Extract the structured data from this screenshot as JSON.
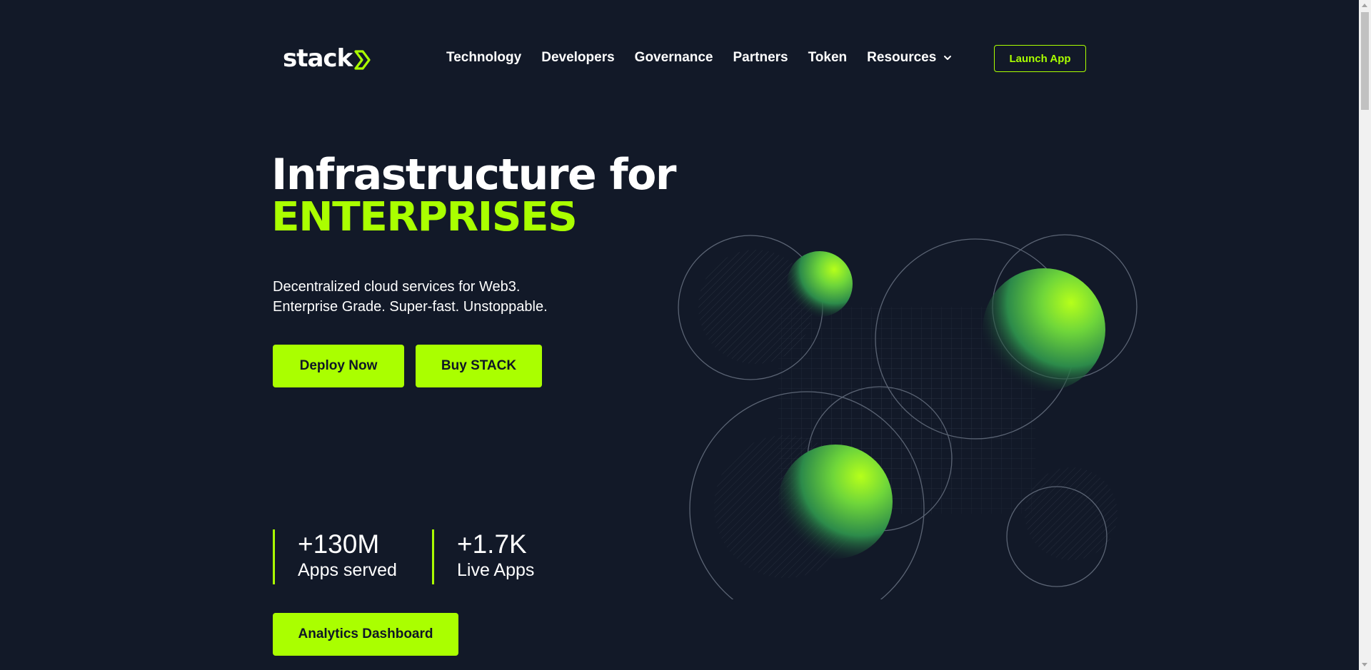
{
  "brand": {
    "logo_text": "stack",
    "accent": "#aaff00",
    "background": "#121928"
  },
  "nav": {
    "items": [
      {
        "label": "Technology"
      },
      {
        "label": "Developers"
      },
      {
        "label": "Governance"
      },
      {
        "label": "Partners"
      },
      {
        "label": "Token"
      },
      {
        "label": "Resources",
        "icon": "chevron-down-icon"
      }
    ],
    "launch_label": "Launch App"
  },
  "hero": {
    "title": "Infrastructure for",
    "accent": "ENTERPRISES",
    "subtitle_line1": "Decentralized cloud services for Web3.",
    "subtitle_line2": "Enterprise Grade. Super-fast. Unstoppable.",
    "primary_cta": "Deploy Now",
    "secondary_cta": "Buy STACK"
  },
  "stats": [
    {
      "value": "+130M",
      "label": "Apps served"
    },
    {
      "value": "+1.7K",
      "label": "Live Apps"
    }
  ],
  "dashboard_cta": "Analytics Dashboard"
}
